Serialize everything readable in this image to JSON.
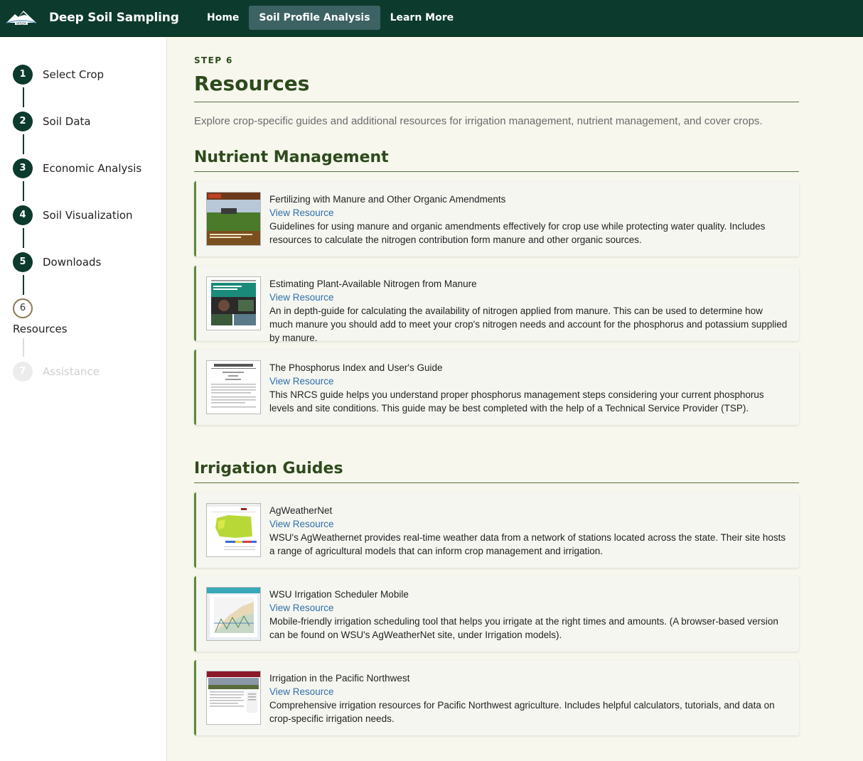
{
  "header": {
    "brand": "Deep Soil Sampling",
    "logo_icon": "wsda-mountain-logo",
    "nav": [
      {
        "label": "Home",
        "active": false
      },
      {
        "label": "Soil Profile Analysis",
        "active": true
      },
      {
        "label": "Learn More",
        "active": false
      }
    ]
  },
  "sidebar": {
    "steps": [
      {
        "number": "1",
        "label": "Select Crop",
        "state": "complete"
      },
      {
        "number": "2",
        "label": "Soil Data",
        "state": "complete"
      },
      {
        "number": "3",
        "label": "Economic Analysis",
        "state": "complete"
      },
      {
        "number": "4",
        "label": "Soil Visualization",
        "state": "complete"
      },
      {
        "number": "5",
        "label": "Downloads",
        "state": "complete"
      },
      {
        "number": "6",
        "label": "Resources",
        "state": "current"
      },
      {
        "number": "7",
        "label": "Assistance",
        "state": "disabled"
      }
    ]
  },
  "main": {
    "kicker": "STEP 6",
    "title": "Resources",
    "intro": "Explore crop-specific guides and additional resources for irrigation management, nutrient management, and cover crops.",
    "link_label": "View Resource",
    "sections": [
      {
        "title": "Nutrient Management",
        "cards": [
          {
            "title": "Fertilizing with Manure and Other Organic Amendments",
            "link": "View Resource",
            "description": "Guidelines for using manure and organic amendments effectively for crop use while protecting water quality. Includes resources to calculate the nitrogen contribution form manure and other organic sources.",
            "thumb_icon": "manure-guide-cover-thumbnail"
          },
          {
            "title": "Estimating Plant-Available Nitrogen from Manure",
            "link": "View Resource",
            "description": "An in depth-guide for calculating the availability of nitrogen applied from manure. This can be used to determine how much manure you should add to meet your crop's nitrogen needs and account for the phosphorus and potassium supplied by manure.",
            "thumb_icon": "nitrogen-guide-cover-thumbnail"
          },
          {
            "title": "The Phosphorus Index and User's Guide",
            "link": "View Resource",
            "description": "This NRCS guide helps you understand proper phosphorus management steps considering your current phosphorus levels and site conditions. This guide may be best completed with the help of a Technical Service Provider (TSP).",
            "thumb_icon": "technical-notes-cover-thumbnail"
          }
        ]
      },
      {
        "title": "Irrigation Guides",
        "cards": [
          {
            "title": "AgWeatherNet",
            "link": "View Resource",
            "description": "WSU's AgWeathernet provides real-time weather data from a network of stations located across the state. Their site hosts a range of agricultural models that can inform crop management and irrigation.",
            "thumb_icon": "agweathernet-map-thumbnail"
          },
          {
            "title": "WSU Irrigation Scheduler Mobile",
            "link": "View Resource",
            "description": "Mobile-friendly irrigation scheduling tool that helps you irrigate at the right times and amounts. (A browser-based version can be found on WSU's AgWeatherNet site, under Irrigation models).",
            "thumb_icon": "irrigation-scheduler-chart-thumbnail"
          },
          {
            "title": "Irrigation in the Pacific Northwest",
            "link": "View Resource",
            "description": "Comprehensive irrigation resources for Pacific Northwest agriculture. Includes helpful calculators, tutorials, and data on crop-specific irrigation needs.",
            "thumb_icon": "pnw-irrigation-site-thumbnail"
          }
        ]
      }
    ]
  },
  "colors": {
    "header_bg": "#0c3a2c",
    "nav_active_bg": "#3d6263",
    "heading_green": "#2d4a1c",
    "card_accent": "#5a8a3a",
    "link_blue": "#2f6fa8",
    "page_bg": "#f7f7ee"
  }
}
